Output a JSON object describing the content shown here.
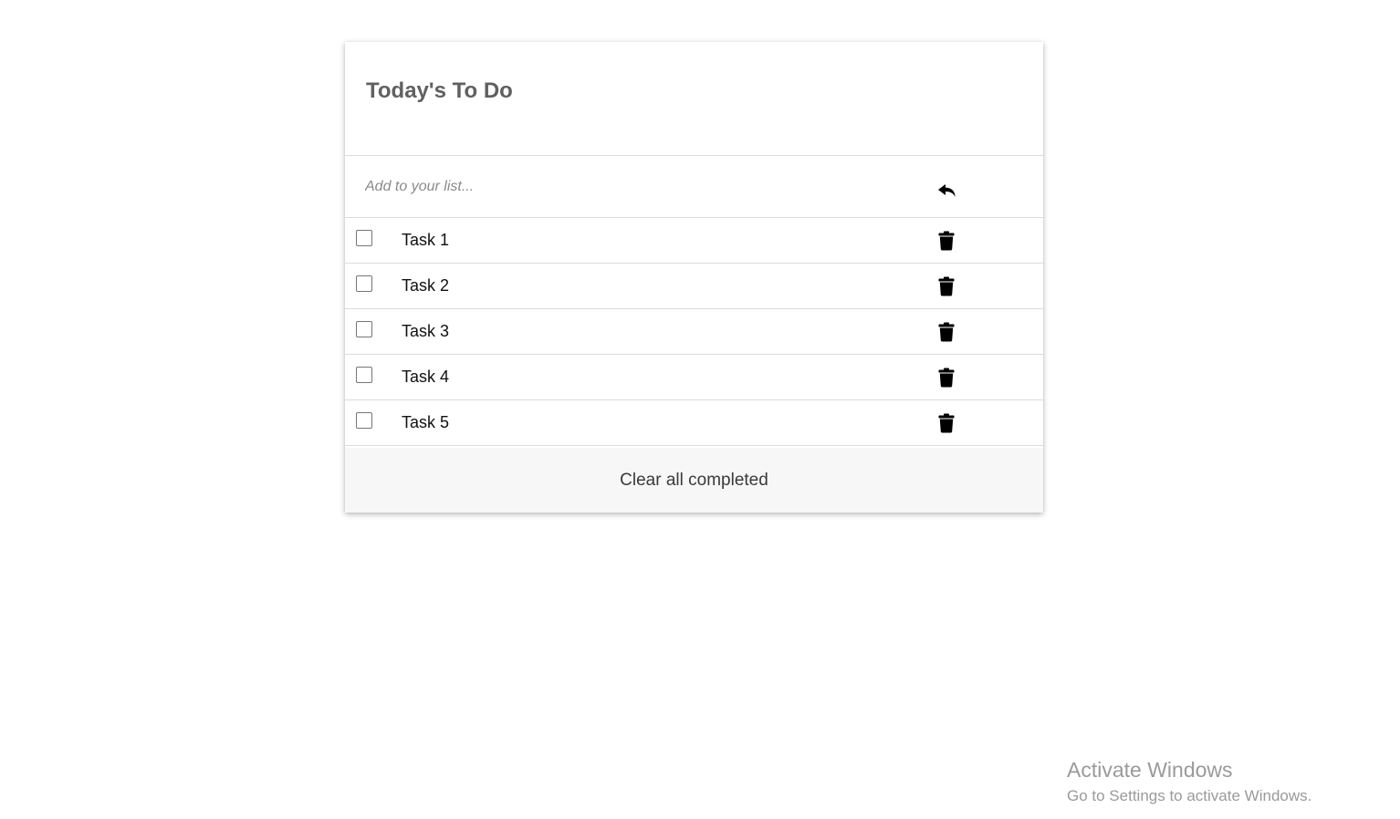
{
  "app": {
    "title": "Today's To Do"
  },
  "add": {
    "placeholder": "Add to your list...",
    "value": "",
    "undo_icon": "undo-arrow-icon"
  },
  "tasks": [
    {
      "label": "Task 1",
      "completed": false,
      "delete_icon": "trash-icon"
    },
    {
      "label": "Task 2",
      "completed": false,
      "delete_icon": "trash-icon"
    },
    {
      "label": "Task 3",
      "completed": false,
      "delete_icon": "trash-icon"
    },
    {
      "label": "Task 4",
      "completed": false,
      "delete_icon": "trash-icon"
    },
    {
      "label": "Task 5",
      "completed": false,
      "delete_icon": "trash-icon"
    }
  ],
  "footer": {
    "clear_label": "Clear all completed"
  },
  "watermark": {
    "title": "Activate Windows",
    "subtitle": "Go to Settings to activate Windows."
  },
  "colors": {
    "title": "#606060",
    "footer_bg": "#f7f7f7",
    "divider": "#dcdcdc"
  }
}
